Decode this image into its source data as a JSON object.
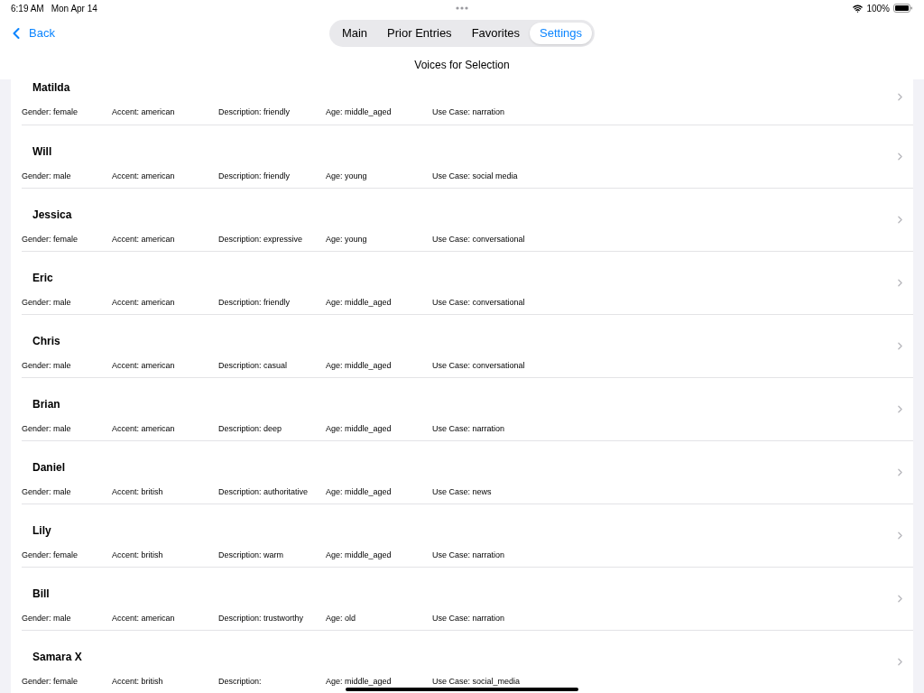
{
  "status_bar": {
    "time": "6:19 AM",
    "date": "Mon Apr 14",
    "battery": "100%"
  },
  "nav": {
    "back": "Back",
    "tabs": [
      {
        "label": "Main",
        "selected": false
      },
      {
        "label": "Prior Entries",
        "selected": false
      },
      {
        "label": "Favorites",
        "selected": false
      },
      {
        "label": "Settings",
        "selected": true
      }
    ]
  },
  "title": "Voices for Selection",
  "voices": [
    {
      "name": "Matilda",
      "gender": "Gender: female",
      "accent": "Accent: american",
      "description": "Description: friendly",
      "age": "Age: middle_aged",
      "use_case": "Use Case: narration"
    },
    {
      "name": "Will",
      "gender": "Gender: male",
      "accent": "Accent: american",
      "description": "Description: friendly",
      "age": "Age: young",
      "use_case": "Use Case: social media"
    },
    {
      "name": "Jessica",
      "gender": "Gender: female",
      "accent": "Accent: american",
      "description": "Description: expressive",
      "age": "Age: young",
      "use_case": "Use Case: conversational"
    },
    {
      "name": "Eric",
      "gender": "Gender: male",
      "accent": "Accent: american",
      "description": "Description: friendly",
      "age": "Age: middle_aged",
      "use_case": "Use Case: conversational"
    },
    {
      "name": "Chris",
      "gender": "Gender: male",
      "accent": "Accent: american",
      "description": "Description: casual",
      "age": "Age: middle_aged",
      "use_case": "Use Case: conversational"
    },
    {
      "name": "Brian",
      "gender": "Gender: male",
      "accent": "Accent: american",
      "description": "Description: deep",
      "age": "Age: middle_aged",
      "use_case": "Use Case: narration"
    },
    {
      "name": "Daniel",
      "gender": "Gender: male",
      "accent": "Accent: british",
      "description": "Description: authoritative",
      "age": "Age: middle_aged",
      "use_case": "Use Case: news"
    },
    {
      "name": "Lily",
      "gender": "Gender: female",
      "accent": "Accent: british",
      "description": "Description: warm",
      "age": "Age: middle_aged",
      "use_case": "Use Case: narration"
    },
    {
      "name": "Bill",
      "gender": "Gender: male",
      "accent": "Accent: american",
      "description": "Description: trustworthy",
      "age": "Age: old",
      "use_case": "Use Case: narration"
    },
    {
      "name": "Samara X",
      "gender": "Gender: female",
      "accent": "Accent: british",
      "description": "Description:",
      "age": "Age: middle_aged",
      "use_case": "Use Case: social_media"
    }
  ]
}
